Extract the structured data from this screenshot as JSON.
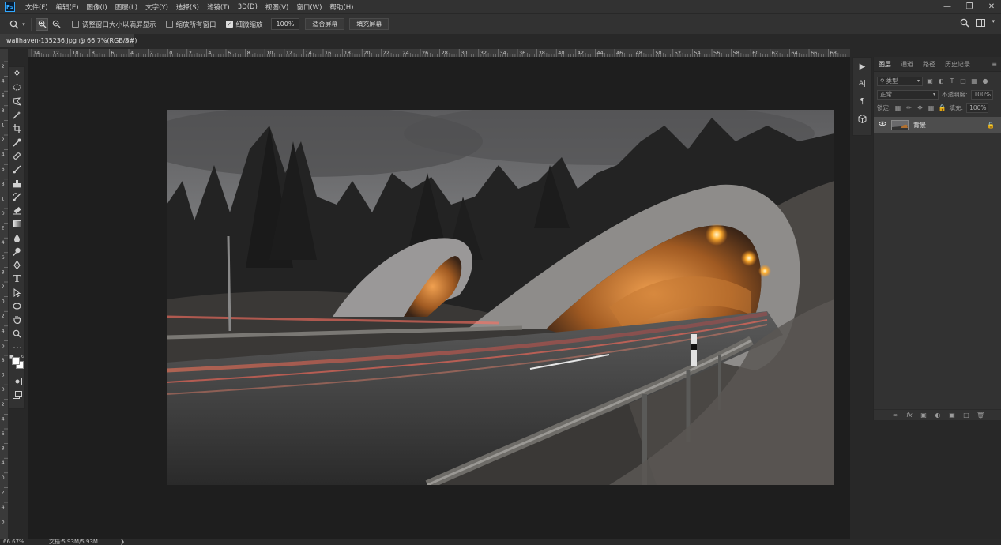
{
  "menubar": {
    "logo": "Ps",
    "items": [
      "文件(F)",
      "编辑(E)",
      "图像(I)",
      "图层(L)",
      "文字(Y)",
      "选择(S)",
      "滤镜(T)",
      "3D(D)",
      "视图(V)",
      "窗口(W)",
      "帮助(H)"
    ],
    "window_controls": [
      "minimize-icon",
      "restore-icon",
      "close-icon"
    ]
  },
  "options": {
    "resize_windows": "调整窗口大小以满屏显示",
    "zoom_all": "缩放所有窗口",
    "scrubby_zoom": "细微缩放",
    "zoom_value": "100%",
    "fit_screen": "适合屏幕",
    "fill_screen": "填充屏幕"
  },
  "document": {
    "tab_title": "wallhaven-135236.jpg @ 66.7%(RGB/8#)",
    "close": "×"
  },
  "ruler_top_labels": [
    "14",
    "12",
    "10",
    "8",
    "6",
    "4",
    "2",
    "0",
    "2",
    "4",
    "6",
    "8",
    "10",
    "12",
    "14",
    "16",
    "18",
    "20",
    "22",
    "24",
    "26",
    "28",
    "30",
    "32",
    "34",
    "36",
    "38",
    "40",
    "42",
    "44",
    "46",
    "48",
    "50",
    "52",
    "54",
    "56",
    "58",
    "60",
    "62",
    "64",
    "66",
    "68"
  ],
  "ruler_left_labels": [
    "2",
    "4",
    "6",
    "8",
    "1",
    "2",
    "4",
    "6",
    "8",
    "1",
    "0",
    "2",
    "4",
    "6",
    "8",
    "2",
    "0",
    "2",
    "4",
    "6",
    "8",
    "3",
    "0",
    "2",
    "4",
    "6",
    "8",
    "4",
    "0",
    "2",
    "4",
    "6"
  ],
  "layers_panel": {
    "tabs": [
      "图层",
      "通道",
      "路径",
      "历史记录"
    ],
    "filter_label": "类型",
    "blend_mode": "正常",
    "opacity_label": "不透明度:",
    "opacity_value": "100%",
    "lock_label": "锁定:",
    "fill_label": "填充:",
    "fill_value": "100%",
    "layer_name": "背景"
  },
  "status": {
    "zoom": "66.67%",
    "doc_size": "文档:5.93M/5.93M"
  },
  "colors": {
    "accent": "#31a8ff",
    "chrome": "#323232",
    "workspace": "#1e1e1e"
  }
}
